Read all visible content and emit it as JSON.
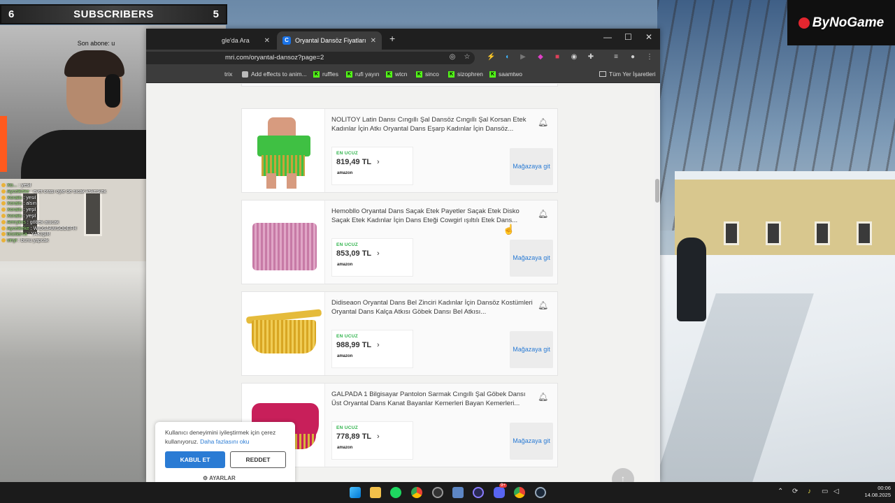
{
  "overlay": {
    "subscribers_left": "6",
    "subscribers_title": "SUBSCRIBERS",
    "subscribers_right": "5",
    "last_subscriber": "Son abone: u",
    "brand": "ByNoGame"
  },
  "chat": [
    {
      "user": "Xo...",
      "text": "yesil"
    },
    {
      "user": "Aycelkeke",
      "text": "evet orası öyle de sıcak kskeskek"
    },
    {
      "user": "Xoralis",
      "text": "yesil"
    },
    {
      "user": "Xoralis",
      "text": "alsın"
    },
    {
      "user": "Xoralis",
      "text": "yeşil"
    },
    {
      "user": "Xoralis",
      "text": "yeşil"
    },
    {
      "user": "Amrykxs",
      "text": "göbek atucak"
    },
    {
      "user": "Aycelkeke",
      "text": "WIDSJAWSODEFH"
    },
    {
      "user": "bozdarca",
      "text": "YAKIŞIR"
    },
    {
      "user": "vinyl",
      "text": "bunu yapcak"
    }
  ],
  "browser": {
    "tab_inactive": "gle'da Ara",
    "tab_active": "Oryantal Dansöz Fiyatları - Sayf",
    "tab_active_favicon": "C",
    "url": "mri.com/oryantal-dansoz?page=2",
    "bookmarks": [
      {
        "label": "trix",
        "icon": "none"
      },
      {
        "label": "Add effects to anim...",
        "icon": "puzzle"
      },
      {
        "label": "ruffles",
        "icon": "kick"
      },
      {
        "label": "rufi yayın",
        "icon": "kick"
      },
      {
        "label": "wtcn",
        "icon": "kick"
      },
      {
        "label": "sinco",
        "icon": "kick"
      },
      {
        "label": "sizophren",
        "icon": "kick"
      },
      {
        "label": "saamtwo",
        "icon": "kick"
      }
    ],
    "bookmarks_all": "Tüm Yer İşaretleri"
  },
  "products": [
    {
      "title": "NOLITOY Latin Dansı Cıngıllı Şal Dansöz Cıngıllı Şal Korsan Etek Kadınlar İçin Atkı Oryantal Dans Eşarp Kadınlar İçin Dansöz...",
      "badge": "EN UCUZ",
      "price": "819,49 TL",
      "store": "amazon",
      "go": "Mağazaya git"
    },
    {
      "title": "Hemobllo Oryantal Dans Saçak Etek Payetler Saçak Etek Disko Saçak Etek Kadınlar İçin Dans Eteği Cowgirl ışıltılı Etek Dans...",
      "badge": "EN UCUZ",
      "price": "853,09 TL",
      "store": "amazon",
      "go": "Mağazaya git"
    },
    {
      "title": "Didiseaon Oryantal Dans Bel Zinciri Kadınlar İçin Dansöz Kostümleri Oryantal Dans Kalça Atkısı Göbek Dansı Bel Atkısı...",
      "badge": "EN UCUZ",
      "price": "988,99 TL",
      "store": "amazon",
      "go": "Mağazaya git"
    },
    {
      "title": "GALPADA 1 Bilgisayar Pantolon Sarmak Cıngıllı Şal Göbek Dansı Üst Oryantal Dans Kanat Bayanlar Kemerleri Bayan Kemerleri...",
      "badge": "EN UCUZ",
      "price": "778,89 TL",
      "store": "amazon",
      "go": "Mağazaya git"
    }
  ],
  "cookie": {
    "text": "Kullanıcı deneyimini iyileştirmek için çerez kullanıyoruz.",
    "link": "Daha fazlasını oku",
    "accept": "KABUL ET",
    "reject": "REDDET",
    "settings": "AYARLAR"
  },
  "taskbar": {
    "time": "00:06",
    "date": "14.08.2025",
    "discord_badge": "9+"
  },
  "colors": {
    "accent": "#2a7bd4",
    "badge_green": "#2eb34a",
    "kick_green": "#53fc18"
  }
}
